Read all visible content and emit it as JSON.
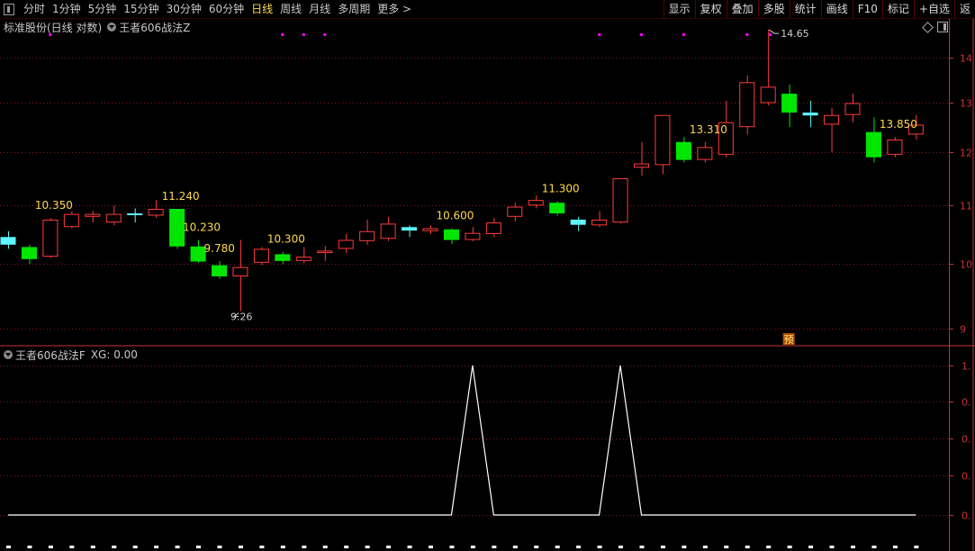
{
  "toolbar": {
    "periods": [
      "分时",
      "1分钟",
      "5分钟",
      "15分钟",
      "30分钟",
      "60分钟",
      "日线",
      "周线",
      "月线",
      "多周期",
      "更多 >"
    ],
    "active": "日线",
    "right_buttons": [
      "显示",
      "复权",
      "叠加",
      "多股",
      "统计",
      "画线",
      "F10",
      "标记",
      "+自选",
      "返"
    ]
  },
  "main_title": {
    "left": "标准股份(日线 对数)",
    "indicator": "王者606战法Z"
  },
  "indicator_panel": {
    "title": "王者606战法F",
    "value_text": "XG: 0.00"
  },
  "badge": "预",
  "colors": {
    "up": "#ff3b3b",
    "down": "#00e600",
    "doji": "#5ff6ff",
    "label": "#ffd84a",
    "grid": "#8a1a1a",
    "axis": "#c83232",
    "marker": "#ff00ff",
    "line": "#ffffff"
  },
  "chart_data": {
    "type": "candlestick",
    "price_axis": {
      "scale": "log",
      "ticks": [
        9,
        10,
        11,
        12,
        13,
        14
      ]
    },
    "candles": [
      {
        "o": 10.45,
        "c": 10.32,
        "h": 10.55,
        "l": 10.25,
        "k": "doji"
      },
      {
        "o": 10.28,
        "c": 10.08,
        "h": 10.32,
        "l": 10.0,
        "k": "down"
      },
      {
        "o": 10.12,
        "c": 10.75,
        "h": 10.78,
        "l": 10.1,
        "k": "up"
      },
      {
        "o": 10.62,
        "c": 10.85,
        "h": 10.9,
        "l": 10.6,
        "k": "up"
      },
      {
        "o": 10.8,
        "c": 10.85,
        "h": 10.9,
        "l": 10.7,
        "k": "up"
      },
      {
        "o": 10.7,
        "c": 10.85,
        "h": 11.0,
        "l": 10.65,
        "k": "up"
      },
      {
        "o": 10.86,
        "c": 10.86,
        "h": 10.95,
        "l": 10.7,
        "k": "doji"
      },
      {
        "o": 10.82,
        "c": 10.94,
        "h": 11.1,
        "l": 10.78,
        "k": "up"
      },
      {
        "o": 10.94,
        "c": 10.29,
        "h": 10.94,
        "l": 10.25,
        "k": "down"
      },
      {
        "o": 10.29,
        "c": 10.04,
        "h": 10.4,
        "l": 10.02,
        "k": "down"
      },
      {
        "o": 9.98,
        "c": 9.8,
        "h": 10.05,
        "l": 9.76,
        "k": "down"
      },
      {
        "o": 9.8,
        "c": 9.95,
        "h": 10.4,
        "l": 9.26,
        "k": "up"
      },
      {
        "o": 10.02,
        "c": 10.25,
        "h": 10.28,
        "l": 9.98,
        "k": "up"
      },
      {
        "o": 10.16,
        "c": 10.05,
        "h": 10.2,
        "l": 10.0,
        "k": "down"
      },
      {
        "o": 10.05,
        "c": 10.12,
        "h": 10.28,
        "l": 10.02,
        "k": "up"
      },
      {
        "o": 10.18,
        "c": 10.22,
        "h": 10.3,
        "l": 10.05,
        "k": "up"
      },
      {
        "o": 10.25,
        "c": 10.4,
        "h": 10.5,
        "l": 10.18,
        "k": "up"
      },
      {
        "o": 10.38,
        "c": 10.55,
        "h": 10.75,
        "l": 10.32,
        "k": "up"
      },
      {
        "o": 10.42,
        "c": 10.68,
        "h": 10.8,
        "l": 10.38,
        "k": "up"
      },
      {
        "o": 10.62,
        "c": 10.56,
        "h": 10.65,
        "l": 10.45,
        "k": "doji"
      },
      {
        "o": 10.55,
        "c": 10.6,
        "h": 10.65,
        "l": 10.5,
        "k": "up"
      },
      {
        "o": 10.58,
        "c": 10.4,
        "h": 10.6,
        "l": 10.33,
        "k": "down"
      },
      {
        "o": 10.4,
        "c": 10.52,
        "h": 10.62,
        "l": 10.38,
        "k": "up"
      },
      {
        "o": 10.5,
        "c": 10.7,
        "h": 10.78,
        "l": 10.45,
        "k": "up"
      },
      {
        "o": 10.8,
        "c": 10.98,
        "h": 11.05,
        "l": 10.72,
        "k": "up"
      },
      {
        "o": 11.0,
        "c": 11.1,
        "h": 11.18,
        "l": 10.95,
        "k": "up"
      },
      {
        "o": 11.05,
        "c": 10.86,
        "h": 11.08,
        "l": 10.82,
        "k": "down"
      },
      {
        "o": 10.75,
        "c": 10.66,
        "h": 10.8,
        "l": 10.55,
        "k": "doji"
      },
      {
        "o": 10.65,
        "c": 10.75,
        "h": 10.9,
        "l": 10.62,
        "k": "up"
      },
      {
        "o": 10.7,
        "c": 11.5,
        "h": 11.5,
        "l": 10.68,
        "k": "up"
      },
      {
        "o": 11.7,
        "c": 11.78,
        "h": 12.2,
        "l": 11.55,
        "k": "up"
      },
      {
        "o": 11.75,
        "c": 12.75,
        "h": 12.75,
        "l": 11.58,
        "k": "up"
      },
      {
        "o": 12.2,
        "c": 11.85,
        "h": 12.3,
        "l": 11.8,
        "k": "down"
      },
      {
        "o": 11.85,
        "c": 12.1,
        "h": 12.2,
        "l": 11.8,
        "k": "up"
      },
      {
        "o": 11.95,
        "c": 12.6,
        "h": 13.05,
        "l": 11.9,
        "k": "up"
      },
      {
        "o": 12.5,
        "c": 13.45,
        "h": 13.6,
        "l": 12.35,
        "k": "up"
      },
      {
        "o": 13.0,
        "c": 13.35,
        "h": 14.65,
        "l": 12.95,
        "k": "up"
      },
      {
        "o": 13.2,
        "c": 12.8,
        "h": 13.4,
        "l": 12.5,
        "k": "down"
      },
      {
        "o": 12.8,
        "c": 12.74,
        "h": 13.05,
        "l": 12.5,
        "k": "doji"
      },
      {
        "o": 12.55,
        "c": 12.75,
        "h": 12.9,
        "l": 12.0,
        "k": "up"
      },
      {
        "o": 12.75,
        "c": 13.0,
        "h": 13.2,
        "l": 12.6,
        "k": "up"
      },
      {
        "o": 12.4,
        "c": 11.9,
        "h": 12.7,
        "l": 11.8,
        "k": "down"
      },
      {
        "o": 11.95,
        "c": 12.25,
        "h": 12.3,
        "l": 11.9,
        "k": "up"
      },
      {
        "o": 12.35,
        "c": 12.55,
        "h": 12.75,
        "l": 12.25,
        "k": "up"
      }
    ],
    "price_labels": [
      {
        "i": 2,
        "text": "10.350",
        "side": "above"
      },
      {
        "i": 8,
        "text": "11.240",
        "side": "above"
      },
      {
        "i": 9,
        "text": "10.230",
        "side": "above"
      },
      {
        "i": 10,
        "text": "9.780",
        "side": "above"
      },
      {
        "i": 13,
        "text": "10.300",
        "side": "above"
      },
      {
        "i": 21,
        "text": "10.600",
        "side": "above"
      },
      {
        "i": 26,
        "text": "11.300",
        "side": "above"
      },
      {
        "i": 33,
        "text": "13.310",
        "side": "above"
      },
      {
        "i": 42,
        "text": "13.850",
        "side": "above"
      }
    ],
    "extremes": [
      {
        "i": 36,
        "value": 14.65,
        "text": "14.65",
        "type": "high"
      },
      {
        "i": 11,
        "value": 9.26,
        "text": "9.26",
        "type": "low"
      }
    ],
    "signal_markers": [
      2,
      13,
      14,
      15,
      28,
      30,
      32,
      35
    ],
    "indicator": {
      "name": "XG",
      "yaxis_ticks": [
        "1.",
        "0.",
        "0.",
        "0.",
        "0.",
        "0."
      ],
      "values": [
        0,
        0,
        0,
        0,
        0,
        0,
        0,
        0,
        0,
        0,
        0,
        0,
        0,
        0,
        0,
        0,
        0,
        0,
        0,
        0,
        0,
        0,
        1,
        0,
        0,
        0,
        0,
        0,
        0,
        1,
        0,
        0,
        0,
        0,
        0,
        0,
        0,
        0,
        0,
        0,
        0,
        0,
        0,
        0
      ]
    }
  }
}
